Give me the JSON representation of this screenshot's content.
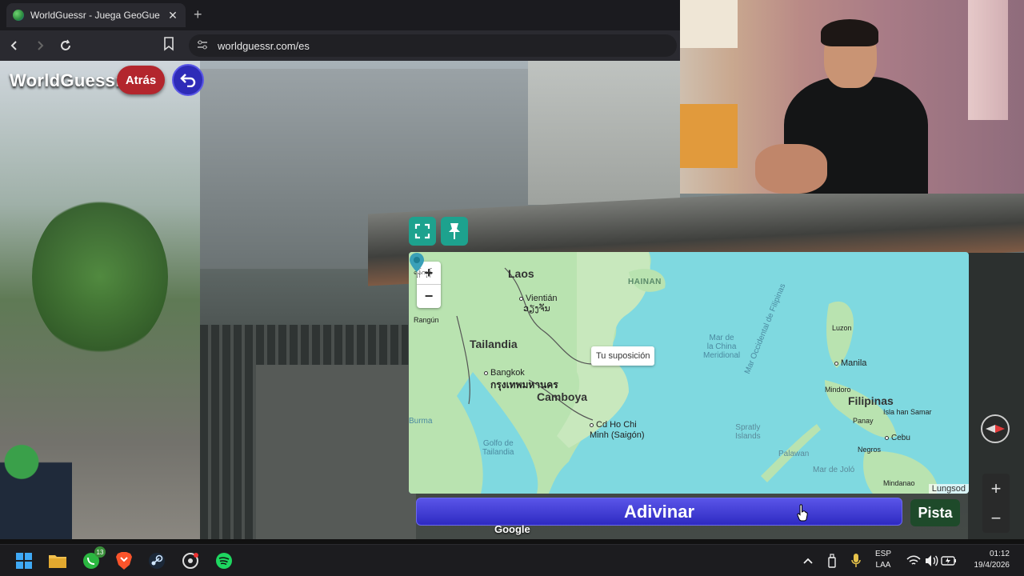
{
  "browser": {
    "tab_title": "WorldGuessr - Juega GeoGuessr",
    "tab_close": "✕",
    "new_tab": "+",
    "url": "worldguessr.com/es"
  },
  "game": {
    "logo": "WorldGuessr",
    "back_label": "Atrás",
    "guess_label": "Adivinar",
    "hint_label": "Pista",
    "street_attribution": "Google"
  },
  "map": {
    "zoom_in": "+",
    "zoom_out": "−",
    "guess_tooltip": "Tu suposición",
    "attribution": "Lungsod",
    "labels": {
      "laos": "Laos",
      "hainan": "HAINAN",
      "vientian": "Vientián",
      "vientian_local": "ວຽງຈັນ",
      "yangon_local": "ရန်ကုန်",
      "rangun": "Rangún",
      "tailandia": "Tailandia",
      "mar_china": "Mar de\nla China\nMeridional",
      "bangkok": "Bangkok",
      "bangkok_local": "กรุงเทพมหานคร",
      "camboya": "Camboya",
      "luzon": "Luzon",
      "manila": "Manila",
      "mar_occ_filipinas": "Mar Occidental de Filipinas",
      "mindoro": "Mindoro",
      "filipinas": "Filipinas",
      "isla_samar": "Isla han Samar",
      "panay": "Panay",
      "cebu": "Cebu",
      "negros": "Negros",
      "burma": "Burma",
      "cd_ho_chi_minh": "Cd Ho Chi\nMinh (Saigón)",
      "spratly": "Spratly\nIslands",
      "golfo_tailandia": "Golfo de\nTailandia",
      "palawan": "Palawan",
      "mar_jolo": "Mar de Joló",
      "mindanao": "Mindanao"
    }
  },
  "side_controls": {
    "zoom_in": "+",
    "zoom_out": "−"
  },
  "taskbar": {
    "whatsapp_badge": "13",
    "lang_line1": "ESP",
    "lang_line2": "LAA",
    "time": "01:12",
    "date": "19/4/2026"
  }
}
